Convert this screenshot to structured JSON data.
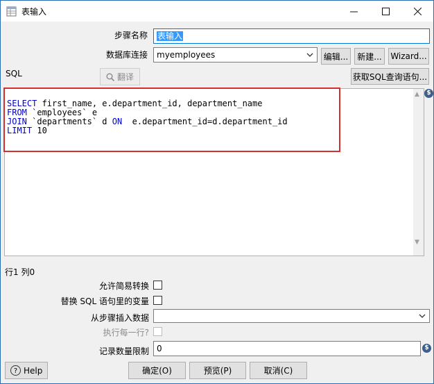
{
  "window": {
    "title": "表输入",
    "minimize_icon": "minimize-icon",
    "maximize_icon": "maximize-icon",
    "close_icon": "close-icon"
  },
  "step_name": {
    "label": "步骤名称",
    "value": "表输入"
  },
  "db_connection": {
    "label": "数据库连接",
    "value": "myemployees",
    "edit_label": "编辑...",
    "new_label": "新建...",
    "wizard_label": "Wizard..."
  },
  "sql": {
    "label": "SQL",
    "translate_label": "翻译",
    "get_sql_label": "获取SQL查询语句...",
    "lines": [
      {
        "kw": "SELECT",
        "rest": " first_name, e.department_id, department_name"
      },
      {
        "kw": "FROM",
        "rest": " `employees` e"
      },
      {
        "kw": "JOIN",
        "rest": " `departments` d ",
        "kw2": "ON",
        "rest2": "  e.department_id=d.department_id"
      },
      {
        "kw": "LIMIT",
        "rest": " 10"
      }
    ]
  },
  "cursor_status": "行1 列0",
  "options": {
    "lazy_conversion_label": "允许简易转换",
    "replace_vars_label": "替换 SQL 语句里的变量",
    "insert_from_step_label": "从步骤插入数据",
    "insert_from_step_value": "",
    "execute_each_row_label": "执行每一行?",
    "limit_label": "记录数量限制",
    "limit_value": "0"
  },
  "footer": {
    "help_label": "Help",
    "ok_label": "确定(O)",
    "preview_label": "预览(P)",
    "cancel_label": "取消(C)"
  },
  "colors": {
    "keyword": "#0000c8",
    "highlight_box": "#d32f2f",
    "selection": "#3399ff"
  }
}
